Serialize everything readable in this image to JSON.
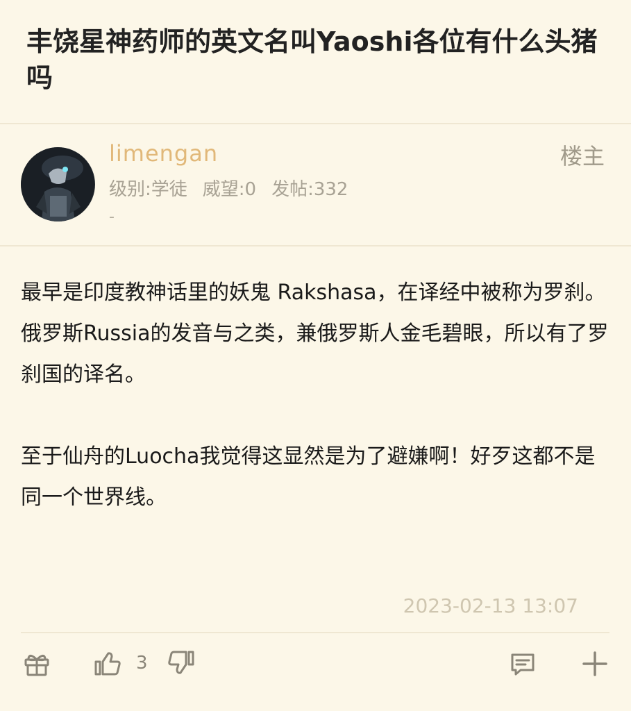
{
  "post": {
    "title": "丰饶星神药师的英文名叫Yaoshi各位有什么头猪吗"
  },
  "author": {
    "username": "limengan",
    "floor_label": "楼主",
    "level": "级别:学徒",
    "prestige": "威望:0",
    "posts": "发帖:332",
    "signature": "-"
  },
  "content": {
    "paragraphs": [
      "最早是印度教神话里的妖鬼 Rakshasa，在译经中被称为罗刹。",
      "俄罗斯Russia的发音与之类，兼俄罗斯人金毛碧眼，所以有了罗刹国的译名。",
      "",
      "至于仙舟的Luocha我觉得这显然是为了避嫌啊！好歹这都不是同一个世界线。"
    ],
    "timestamp": "2023-02-13 13:07"
  },
  "actions": {
    "gift_icon": "gift-icon",
    "like_icon": "thumbs-up-icon",
    "like_count": "3",
    "dislike_icon": "thumbs-down-icon",
    "reply_icon": "comment-icon",
    "more_icon": "plus-icon"
  },
  "colors": {
    "background": "#fcf7e8",
    "username": "#e1b879",
    "muted": "#a8a294",
    "icon": "#8a8578"
  }
}
